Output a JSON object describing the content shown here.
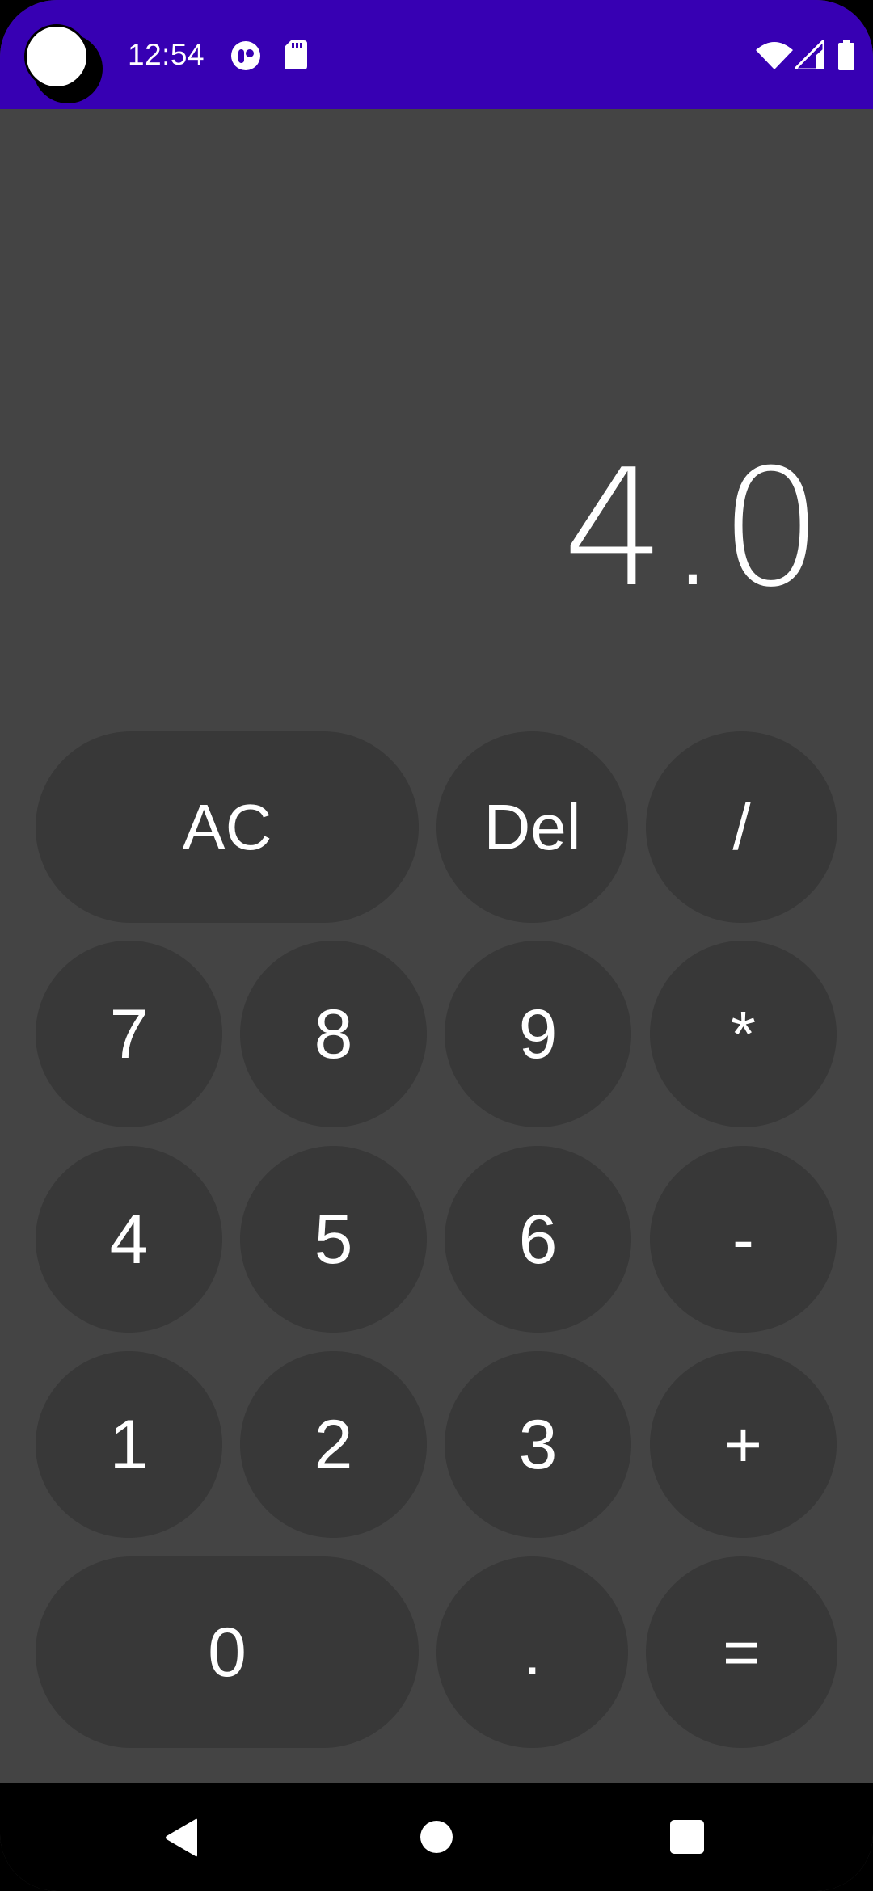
{
  "status_bar": {
    "time": "12:54",
    "background_color": "#3700b3",
    "left_icons": [
      "bubble-icon",
      "app-notification-icon",
      "sd-card-icon"
    ],
    "right_icons": [
      "wifi-icon",
      "cell-signal-icon",
      "battery-icon"
    ]
  },
  "display": {
    "value": "4.0"
  },
  "keypad": {
    "rows": [
      [
        "AC",
        "Del",
        "/"
      ],
      [
        "7",
        "8",
        "9",
        "*"
      ],
      [
        "4",
        "5",
        "6",
        "-"
      ],
      [
        "1",
        "2",
        "3",
        "+"
      ],
      [
        "0",
        ".",
        "="
      ]
    ],
    "labels": {
      "ac": "AC",
      "del": "Del",
      "divide": "/",
      "seven": "7",
      "eight": "8",
      "nine": "9",
      "multiply": "*",
      "four": "4",
      "five": "5",
      "six": "6",
      "minus": "-",
      "one": "1",
      "two": "2",
      "three": "3",
      "plus": "+",
      "zero": "0",
      "dot": ".",
      "equals": "="
    },
    "button_color": "#383838",
    "background_color": "#444444"
  },
  "nav_bar": {
    "buttons": [
      "back-icon",
      "home-icon",
      "recents-icon"
    ]
  }
}
